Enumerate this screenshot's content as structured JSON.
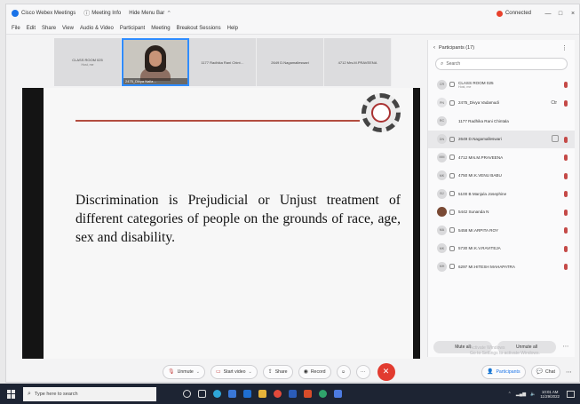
{
  "window": {
    "app_title": "Cisco Webex Meetings",
    "menu_meeting_info": "Meeting Info",
    "menu_hide_bar": "Hide Menu Bar",
    "status": "Connected",
    "controls": [
      "—",
      "□",
      "×"
    ]
  },
  "menubar": [
    "File",
    "Edit",
    "Share",
    "View",
    "Audio & Video",
    "Participant",
    "Meeting",
    "Breakout Sessions",
    "Help"
  ],
  "thumbnails": [
    {
      "name": "CLASS ROOM 025",
      "sub": "Host, me"
    },
    {
      "name": "2475_Divya Nalla…",
      "video": true
    },
    {
      "name": "1177 Radhika Rani Chint…"
    },
    {
      "name": "2649 D.Nagamalleswari"
    },
    {
      "name": "4712 Mrs.M.PRAVEENA"
    }
  ],
  "slide": {
    "body": "Discrimination is Prejudicial or Unjust treatment of different categories of people on the grounds of race, age, sex and disability."
  },
  "participants": {
    "title": "Participants (17)",
    "search_placeholder": "Search",
    "rows": [
      {
        "initials": "CR",
        "name": "CLASS ROOM 025",
        "sub": "Host, me",
        "mic": true
      },
      {
        "initials": "PN",
        "name": "2475_Divya Vadamudi",
        "extra": "Ctr",
        "mic": true
      },
      {
        "initials": "RC",
        "name": "1177 Radhika Rani Chintala",
        "mic": false
      },
      {
        "initials": "DN",
        "name": "2649 D.Nagamalleswari",
        "mic": true,
        "selected": true
      },
      {
        "initials": "MM",
        "name": "4712 Mrs.M.PRAVEENA",
        "mic": true
      },
      {
        "initials": "MK",
        "name": "4750 Mr.K.VENU BABU",
        "mic": true
      },
      {
        "initials": "BJ",
        "name": "5100 B Manjula Josephine",
        "mic": true
      },
      {
        "initials": "SN",
        "name": "5442 Sunanda N",
        "mic": true,
        "photo": true
      },
      {
        "initials": "MA",
        "name": "5458 Mr.ARPITA ROY",
        "mic": true
      },
      {
        "initials": "MK",
        "name": "5730 Mr.K.V.RAVITEJA",
        "mic": true
      },
      {
        "initials": "MH",
        "name": "6297 Mr.HITESH MAHAPATRA",
        "mic": true
      }
    ],
    "mute_all": "Mute all",
    "unmute_all": "Unmute all"
  },
  "controls": {
    "unmute": "Unmute",
    "start_video": "Start video",
    "share": "Share",
    "record": "Record",
    "participants": "Participants",
    "chat": "Chat"
  },
  "watermark": {
    "line1": "Activate Windows",
    "line2": "Go to Settings to activate Windows."
  },
  "taskbar": {
    "search_placeholder": "Type here to search",
    "time": "10:01 AM",
    "date": "11/29/2022"
  },
  "colors": {
    "accent": "#1a73e8",
    "end_call": "#e23b2f",
    "slide_rule": "#b34d3f",
    "taskbar": "#1d2433"
  }
}
